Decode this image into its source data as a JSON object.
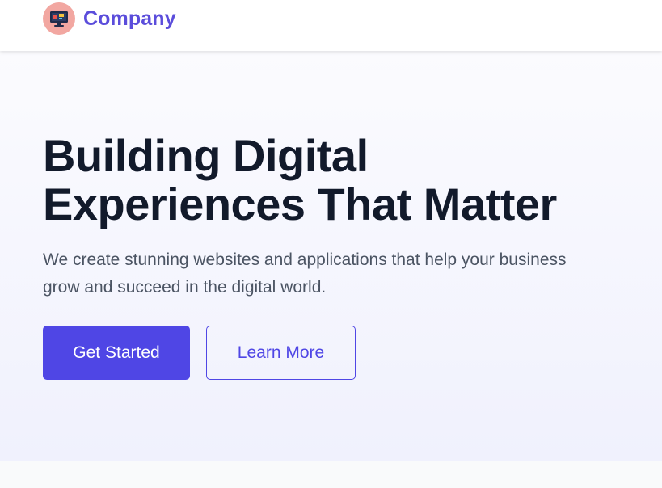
{
  "header": {
    "brand_name": "Company",
    "logo_icon": "computer-monitor-icon"
  },
  "hero": {
    "headline_line1": "Building Digital",
    "headline_line2": "Experiences That Matter",
    "subtext_line1": "We create stunning websites and applications that help your business",
    "subtext_line2": "grow and succeed in the digital world.",
    "primary_button": "Get Started",
    "secondary_button": "Learn More"
  },
  "colors": {
    "accent": "#4f46e5",
    "brand_text": "#5b4ddb",
    "heading": "#121a2b",
    "body_text": "#4b5463",
    "logo_bg": "#f2a7a1"
  }
}
